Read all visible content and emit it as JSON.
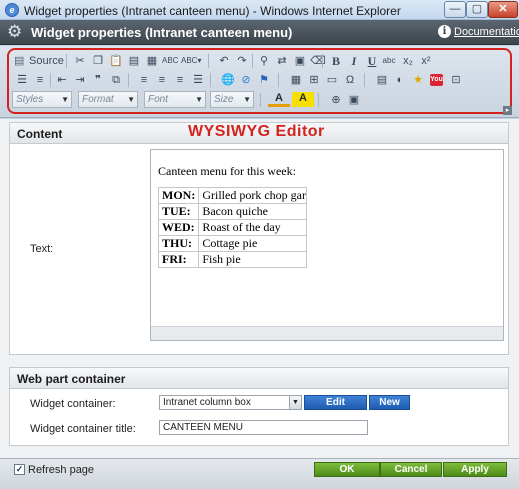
{
  "window": {
    "title": "Widget properties (Intranet canteen menu) - Windows Internet Explorer",
    "ie_icon_glyph": "e",
    "minimize_glyph": "—",
    "maximize_glyph": "▢",
    "close_glyph": "✕"
  },
  "header": {
    "title": "Widget properties (Intranet canteen menu)",
    "documentation_link": "Documentation",
    "help_icon_glyph": "i",
    "settings_icon_glyph": "⚙"
  },
  "toolbar": {
    "source_label": "Source",
    "styles_placeholder": "Styles",
    "format_placeholder": "Format",
    "font_placeholder": "Font",
    "size_placeholder": "Size",
    "text_color_glyph": "A",
    "bg_color_glyph": "A",
    "youtube_label": "You",
    "annotation_color": "#d3231f",
    "row1_icons": [
      "cut-icon",
      "copy-icon",
      "paste-icon",
      "paste-text-icon",
      "paste-word-icon",
      "spellcheck-icon",
      "spellcheck-as-you-type-icon",
      "undo-icon",
      "redo-icon",
      "find-icon",
      "replace-icon",
      "select-all-icon",
      "remove-format-icon",
      "bold-icon",
      "italic-icon",
      "underline-icon",
      "strike-icon",
      "subscript-icon",
      "superscript-icon"
    ],
    "row2_icons": [
      "numbered-list-icon",
      "bulleted-list-icon",
      "outdent-icon",
      "indent-icon",
      "blockquote-icon",
      "create-div-icon",
      "align-left-icon",
      "align-center-icon",
      "align-right-icon",
      "justify-icon",
      "link-icon",
      "unlink-icon",
      "anchor-icon",
      "image-icon",
      "table-icon",
      "horizontal-rule-icon",
      "special-char-icon",
      "media-icon",
      "quick-media-icon",
      "star-icon",
      "youtube-icon",
      "widget-icon"
    ],
    "row3_icons": [
      "text-color-icon",
      "bg-color-icon",
      "maximize-icon",
      "show-blocks-icon"
    ]
  },
  "content": {
    "section_title": "Content",
    "annotation": "WYSIWYG Editor",
    "text_label": "Text:",
    "editor_intro": "Canteen menu for this week:",
    "menu": [
      {
        "day": "MON:",
        "dish": "Grilled pork chop garni"
      },
      {
        "day": "TUE:",
        "dish": "Bacon quiche"
      },
      {
        "day": "WED:",
        "dish": "Roast of the day"
      },
      {
        "day": "THU:",
        "dish": "Cottage pie"
      },
      {
        "day": "FRI:",
        "dish": "Fish pie"
      }
    ]
  },
  "container": {
    "section_title": "Web part container",
    "widget_container_label": "Widget container:",
    "widget_container_value": "Intranet column box",
    "edit_button": "Edit",
    "new_button": "New",
    "widget_container_title_label": "Widget container title:",
    "widget_container_title_value": "CANTEEN MENU"
  },
  "footer": {
    "refresh_label": "Refresh page",
    "refresh_checked": true,
    "check_glyph": "✓",
    "ok_button": "OK",
    "cancel_button": "Cancel",
    "apply_button": "Apply"
  }
}
